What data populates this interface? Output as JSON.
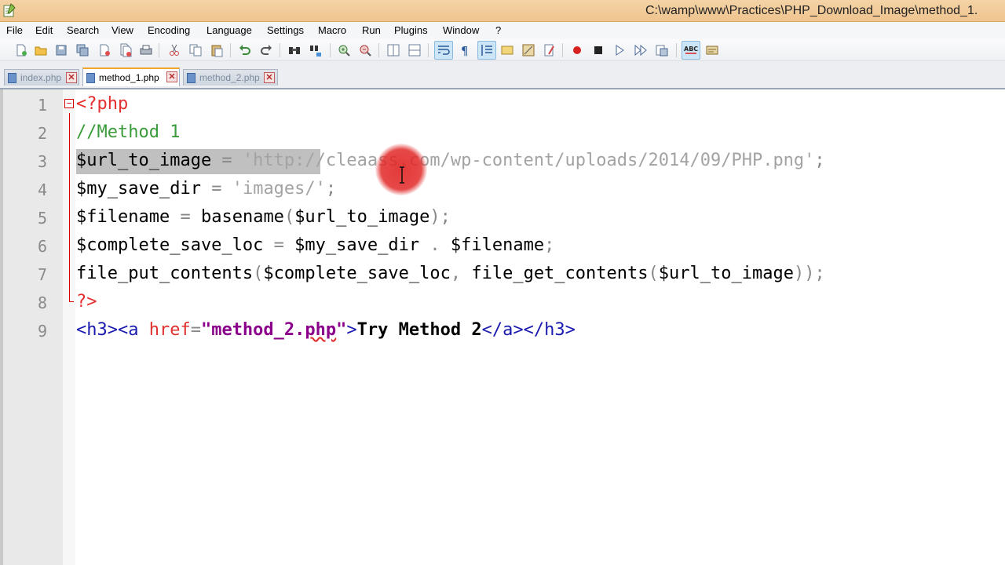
{
  "window": {
    "title": "C:\\wamp\\www\\Practices\\PHP_Download_Image\\method_1."
  },
  "menu": [
    "File",
    "Edit",
    "Search",
    "View",
    "Encoding",
    "Language",
    "Settings",
    "Macro",
    "Run",
    "Plugins",
    "Window",
    "?"
  ],
  "toolbar": {
    "icons": [
      "new-file-icon",
      "open-file-icon",
      "save-icon",
      "save-all-icon",
      "close-icon",
      "close-all-icon",
      "print-icon",
      "cut-icon",
      "copy-icon",
      "paste-icon",
      "undo-icon",
      "redo-icon",
      "find-icon",
      "replace-icon",
      "zoom-in-icon",
      "zoom-out-icon",
      "sync-vertical-icon",
      "sync-horizontal-icon",
      "word-wrap-icon",
      "show-all-chars-icon",
      "indent-guide-icon",
      "user-lang-icon",
      "doc-map-icon",
      "function-list-icon",
      "record-macro-icon",
      "stop-macro-icon",
      "play-macro-icon",
      "run-macro-multiple-icon",
      "save-macro-icon",
      "spell-check-icon",
      "view-in-browser-icon"
    ]
  },
  "tabs": [
    {
      "label": "index.php",
      "active": false
    },
    {
      "label": "method_1.php",
      "active": true
    },
    {
      "label": "method_2.php",
      "active": false
    }
  ],
  "editor": {
    "lines": [
      {
        "n": "1",
        "tokens": [
          {
            "t": "<?php",
            "c": "php"
          }
        ]
      },
      {
        "n": "2",
        "tokens": [
          {
            "t": "//Method 1",
            "c": "comment"
          }
        ]
      },
      {
        "n": "3",
        "tokens": [
          {
            "t": "$url_to_image",
            "c": "var"
          },
          {
            "t": " = ",
            "c": "op"
          },
          {
            "t": "'http://cleaass.com/wp-content/uploads/2014/09/PHP.png'",
            "c": "str"
          },
          {
            "t": ";",
            "c": "op"
          }
        ]
      },
      {
        "n": "4",
        "tokens": [
          {
            "t": "$my_save_dir",
            "c": "var"
          },
          {
            "t": " = ",
            "c": "op"
          },
          {
            "t": "'images/'",
            "c": "str"
          },
          {
            "t": ";",
            "c": "op"
          }
        ]
      },
      {
        "n": "5",
        "tokens": [
          {
            "t": "$filename",
            "c": "var"
          },
          {
            "t": " = ",
            "c": "op"
          },
          {
            "t": "basename",
            "c": "var"
          },
          {
            "t": "(",
            "c": "op"
          },
          {
            "t": "$url_to_image",
            "c": "var"
          },
          {
            "t": ");",
            "c": "op"
          }
        ]
      },
      {
        "n": "6",
        "tokens": [
          {
            "t": "$complete_save_loc",
            "c": "var"
          },
          {
            "t": " = ",
            "c": "op"
          },
          {
            "t": "$my_save_dir",
            "c": "var"
          },
          {
            "t": " . ",
            "c": "op"
          },
          {
            "t": "$filename",
            "c": "var"
          },
          {
            "t": ";",
            "c": "op"
          }
        ]
      },
      {
        "n": "7",
        "tokens": [
          {
            "t": "file_put_contents",
            "c": "var"
          },
          {
            "t": "(",
            "c": "op"
          },
          {
            "t": "$complete_save_loc",
            "c": "var"
          },
          {
            "t": ", ",
            "c": "op"
          },
          {
            "t": "file_get_contents",
            "c": "var"
          },
          {
            "t": "(",
            "c": "op"
          },
          {
            "t": "$url_to_image",
            "c": "var"
          },
          {
            "t": "));",
            "c": "op"
          }
        ]
      },
      {
        "n": "8",
        "tokens": [
          {
            "t": "?>",
            "c": "php"
          }
        ]
      },
      {
        "n": "9",
        "tokens": [
          {
            "t": "<h3><a ",
            "c": "tag"
          },
          {
            "t": "href",
            "c": "attr"
          },
          {
            "t": "=",
            "c": "op"
          },
          {
            "t": "\"method_2.",
            "c": "val"
          },
          {
            "t": "php",
            "c": "valsq"
          },
          {
            "t": "\"",
            "c": "val"
          },
          {
            "t": ">",
            "c": "tag"
          },
          {
            "t": "Try Method 2",
            "c": "text"
          },
          {
            "t": "</a></h3>",
            "c": "tag"
          }
        ]
      }
    ],
    "selected_text": "$url_to_image = '"
  },
  "colors": {
    "titlebar": "#efc48f",
    "php_tag": "#e62e2e",
    "comment": "#3b9b3b",
    "string": "#a3a3a3",
    "html_tag": "#1a1ab0",
    "attr_value": "#8b008b",
    "selection": "#c0c0c0",
    "cursor_highlight": "#e22828"
  }
}
